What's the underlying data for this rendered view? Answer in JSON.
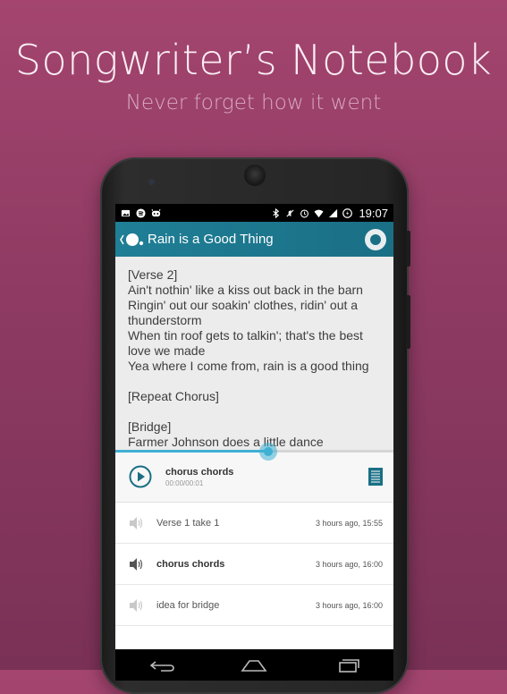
{
  "hero": {
    "title": "Songwriter’s Notebook",
    "subtitle": "Never forget how it went"
  },
  "statusbar": {
    "time": "19:07",
    "left_icons": [
      "gallery-icon",
      "spotify-icon",
      "cyanogen-icon"
    ],
    "right_icons": [
      "bluetooth-icon",
      "mute-icon",
      "alarm-icon",
      "wifi-icon",
      "signal-icon",
      "battery-icon"
    ]
  },
  "toolbar": {
    "title": "Rain is a Good Thing",
    "back_icon": "back-chevron-icon",
    "record_icon": "record-icon"
  },
  "lyrics": {
    "lines": [
      "[Verse 2]",
      "Ain't nothin' like a kiss out back in the barn",
      "Ringin' out our soakin' clothes, ridin' out a",
      "thunderstorm",
      "When tin roof gets to talkin'; that's the best",
      "love we made",
      "Yea where I come from, rain is a good thing",
      "",
      "[Repeat Chorus]",
      "",
      "[Bridge]",
      "Farmer Johnson does a little dance"
    ]
  },
  "player": {
    "title": "chorus chords",
    "time": "00:00/00:01",
    "progress": 0.55,
    "play_icon": "play-icon",
    "notes_icon": "notes-icon"
  },
  "recordings": [
    {
      "name": "Verse 1 take 1",
      "time": "3 hours ago, 15:55",
      "active": false
    },
    {
      "name": "chorus chords",
      "time": "3 hours ago, 16:00",
      "active": true
    },
    {
      "name": "idea for bridge",
      "time": "3 hours ago, 16:00",
      "active": false
    }
  ],
  "navbar": {
    "icons": [
      "back-icon",
      "home-icon",
      "recent-apps-icon"
    ]
  },
  "colors": {
    "background": "#9b4169",
    "accent": "#1f7f96",
    "seek": "#3fb0d3"
  }
}
